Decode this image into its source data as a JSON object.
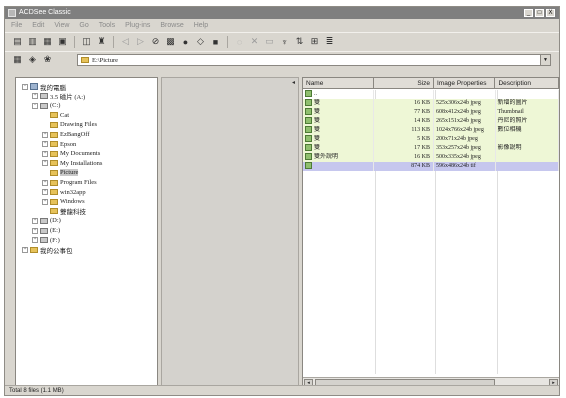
{
  "window": {
    "title": "ACDSee Classic",
    "caption_buttons": [
      "_",
      "□",
      "X"
    ]
  },
  "menu": [
    "File",
    "Edit",
    "View",
    "Go",
    "Tools",
    "Plug-ins",
    "Browse",
    "Help"
  ],
  "toolbar1_icons": [
    "folder-icon",
    "copy-icon",
    "paste-icon",
    "view-icon",
    "new-icon",
    "find-icon",
    "back-icon",
    "forward-icon",
    "up-icon",
    "print-icon",
    "scan-icon",
    "tool-icon",
    "zoom-icon",
    "filter-icon",
    "delete-icon",
    "rename-icon",
    "properties-icon",
    "sort-icon",
    "grid-icon"
  ],
  "toolbar2_icons": [
    "home-icon",
    "refresh-icon",
    "favorite-icon"
  ],
  "address": {
    "value": "E:\\Picture"
  },
  "tree": [
    {
      "label": "我的電腦",
      "icon": "pc",
      "indent": 0,
      "expander": "-"
    },
    {
      "label": "3.5 磁片 (A:)",
      "icon": "drive",
      "indent": 1,
      "expander": "+"
    },
    {
      "label": "(C:)",
      "icon": "drive",
      "indent": 1,
      "expander": "-"
    },
    {
      "label": "Cat",
      "icon": "folder",
      "indent": 2,
      "expander": ""
    },
    {
      "label": "Drawing Files",
      "icon": "folder",
      "indent": 2,
      "expander": ""
    },
    {
      "label": "EzBangOff",
      "icon": "folder",
      "indent": 2,
      "expander": "+"
    },
    {
      "label": "Epson",
      "icon": "folder",
      "indent": 2,
      "expander": "+"
    },
    {
      "label": "My Documents",
      "icon": "folder",
      "indent": 2,
      "expander": "+"
    },
    {
      "label": "My Installations",
      "icon": "folder",
      "indent": 2,
      "expander": "+"
    },
    {
      "label": "Picture",
      "icon": "folder",
      "indent": 2,
      "expander": "",
      "selected": true
    },
    {
      "label": "Program Files",
      "icon": "folder",
      "indent": 2,
      "expander": "+"
    },
    {
      "label": "win32app",
      "icon": "folder",
      "indent": 2,
      "expander": "+"
    },
    {
      "label": "Windows",
      "icon": "folder",
      "indent": 2,
      "expander": "+"
    },
    {
      "label": "雙龍科技",
      "icon": "folder",
      "indent": 2,
      "expander": ""
    },
    {
      "label": "(D:)",
      "icon": "drive",
      "indent": 1,
      "expander": "+"
    },
    {
      "label": "(E:)",
      "icon": "drive",
      "indent": 1,
      "expander": "+"
    },
    {
      "label": "(F:)",
      "icon": "drive",
      "indent": 1,
      "expander": "+"
    },
    {
      "label": "我的公事包",
      "icon": "folder",
      "indent": 0,
      "expander": "+"
    }
  ],
  "list": {
    "columns": [
      "Name",
      "Size",
      "Image Properties",
      "Description"
    ],
    "rows": [
      {
        "name": "..",
        "size": "",
        "props": "",
        "desc": "",
        "style": ""
      },
      {
        "name": "雙",
        "size": "16 KB",
        "props": "525x306x24b jpeg",
        "desc": "新增的圖片",
        "style": "hl"
      },
      {
        "name": "雙",
        "size": "77 KB",
        "props": "608x412x24b jpeg",
        "desc": "Thumbnail",
        "style": "hl"
      },
      {
        "name": "雙",
        "size": "14 KB",
        "props": "265x151x24b jpeg",
        "desc": "丹尼的照片",
        "style": "hl"
      },
      {
        "name": "雙",
        "size": "113 KB",
        "props": "1024x766x24b jpeg",
        "desc": "數位相機",
        "style": "hl"
      },
      {
        "name": "雙",
        "size": "5 KB",
        "props": "200x71x24b jpeg",
        "desc": "",
        "style": "hl"
      },
      {
        "name": "雙",
        "size": "17 KB",
        "props": "353x257x24b jpeg",
        "desc": "影像說明",
        "style": "hl"
      },
      {
        "name": "雙外說明",
        "size": "16 KB",
        "props": "500x335x24b jpeg",
        "desc": "",
        "style": "hl"
      },
      {
        "name": "",
        "size": "874 KB",
        "props": "596x486x24b tif",
        "desc": "",
        "style": "sel"
      }
    ]
  },
  "status": "Total 8 files (1.1 MB)"
}
